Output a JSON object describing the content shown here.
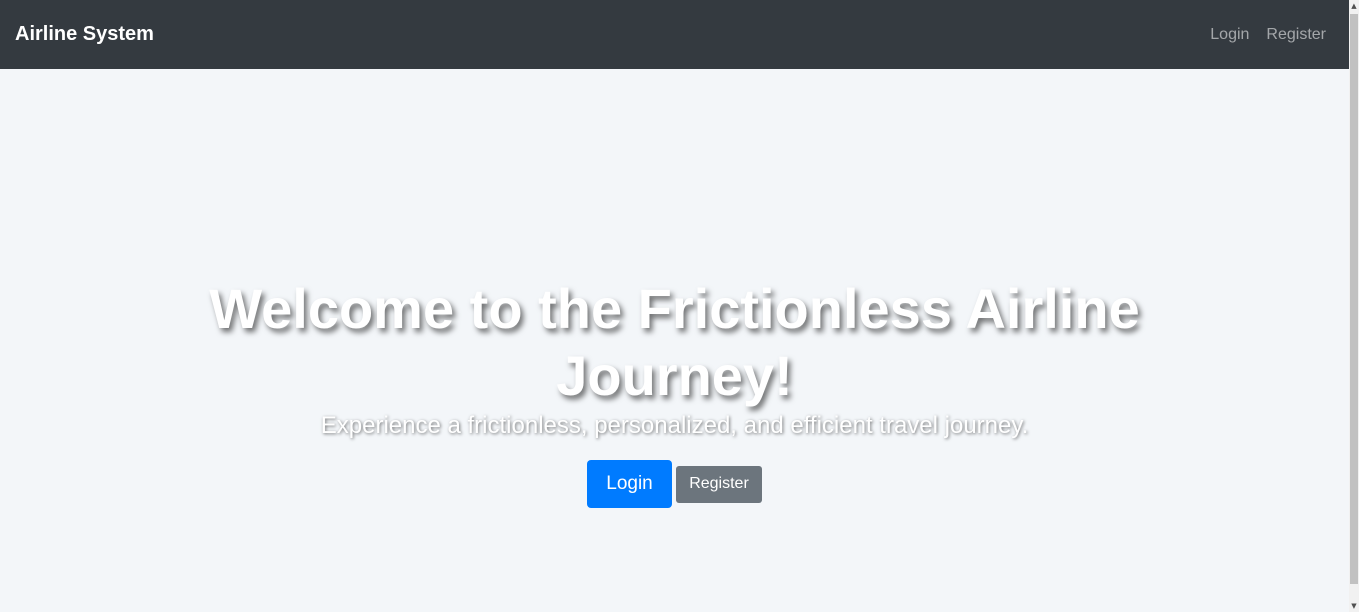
{
  "navbar": {
    "brand": "Airline System",
    "links": [
      "Login",
      "Register"
    ]
  },
  "hero": {
    "title": "Welcome to the Frictionless Airline Journey!",
    "subtitle": "Experience a frictionless, personalized, and efficient travel journey.",
    "login_label": "Login",
    "register_label": "Register"
  },
  "colors": {
    "navbar_bg": "#343a40",
    "page_bg": "#f3f6f9",
    "primary": "#007bff",
    "secondary": "#6c757d"
  },
  "icons": {
    "scroll_up": "scroll-up-arrow-icon",
    "scroll_down": "scroll-down-arrow-icon"
  }
}
